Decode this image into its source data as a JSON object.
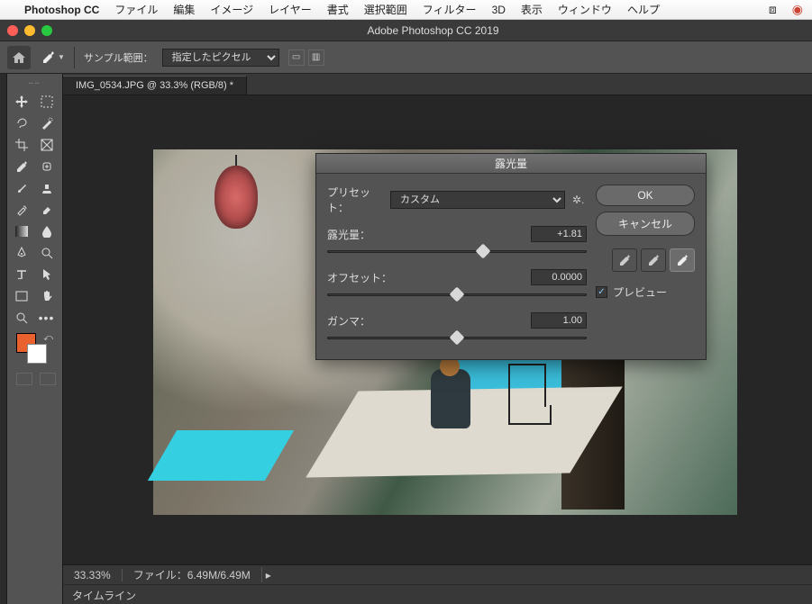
{
  "menubar": {
    "app": "Photoshop CC",
    "items": [
      "ファイル",
      "編集",
      "イメージ",
      "レイヤー",
      "書式",
      "選択範囲",
      "フィルター",
      "3D",
      "表示",
      "ウィンドウ",
      "ヘルプ"
    ]
  },
  "window": {
    "title": "Adobe Photoshop CC 2019"
  },
  "options": {
    "sample_label": "サンプル範囲：",
    "sample_select": "指定したピクセル"
  },
  "document": {
    "tab": "IMG_0534.JPG @ 33.3% (RGB/8) *"
  },
  "status": {
    "zoom": "33.33%",
    "file_label": "ファイル：",
    "file_value": "6.49M/6.49M"
  },
  "panels": {
    "timeline": "タイムライン"
  },
  "swatches": {
    "fg": "#e8612f",
    "bg": "#ffffff"
  },
  "dialog": {
    "title": "露光量",
    "preset_label": "プリセット：",
    "preset_value": "カスタム",
    "exposure": {
      "label": "露光量：",
      "value": "+1.81"
    },
    "offset": {
      "label": "オフセット：",
      "value": "0.0000"
    },
    "gamma": {
      "label": "ガンマ：",
      "value": "1.00"
    },
    "ok": "OK",
    "cancel": "キャンセル",
    "preview_label": "プレビュー",
    "preview_checked": true
  },
  "chart_data": {
    "type": "table",
    "title": "露光量",
    "rows": [
      {
        "param": "露光量",
        "value": 1.81
      },
      {
        "param": "オフセット",
        "value": 0.0
      },
      {
        "param": "ガンマ",
        "value": 1.0
      }
    ]
  }
}
